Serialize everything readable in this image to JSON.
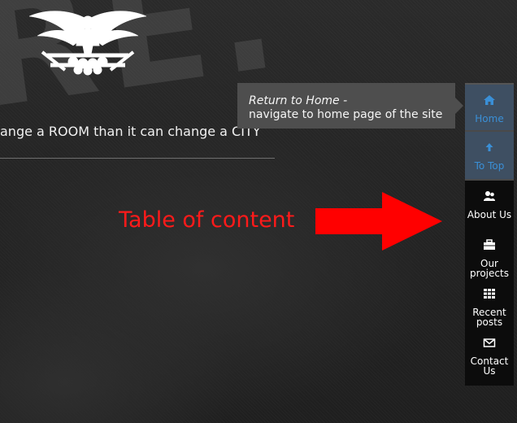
{
  "header": {
    "background_letters": "RE.",
    "tagline": "ange a ROOM than it can change a CITY"
  },
  "annotation": {
    "text": "Table of content",
    "color": "#ff1a1a"
  },
  "tooltip": {
    "title": "Return to Home -",
    "description": "navigate to home page of the site"
  },
  "sidenav": {
    "items": [
      {
        "label": "Home",
        "icon": "home-icon"
      },
      {
        "label": "To Top",
        "icon": "arrow-up-icon"
      },
      {
        "label": "About Us",
        "icon": "users-icon"
      },
      {
        "label_line1": "Our",
        "label_line2": "projects",
        "icon": "briefcase-icon"
      },
      {
        "label_line1": "Recent",
        "label_line2": "posts",
        "icon": "grid-icon"
      },
      {
        "label_line1": "Contact",
        "label_line2": "Us",
        "icon": "envelope-icon"
      }
    ]
  },
  "colors": {
    "accent_blue": "#3a8fd6",
    "nav_active_bg": "#3e4f62",
    "nav_dark_bg": "#0c0c0c"
  }
}
